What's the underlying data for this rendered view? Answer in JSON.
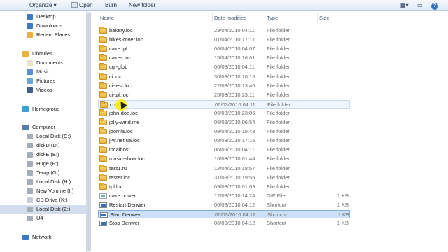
{
  "toolbar": {
    "organize_label": "Organize ▾",
    "open_label": "Open",
    "burn_label": "Burn",
    "new_folder_label": "New folder"
  },
  "nav": {
    "items": [
      {
        "label": "Desktop",
        "icon": "desktop-icon"
      },
      {
        "label": "Downloads",
        "icon": "downloads-folder-icon"
      },
      {
        "label": "Recent Places",
        "icon": "recent-places-icon"
      },
      {
        "label": "Libraries",
        "icon": "libraries-icon"
      },
      {
        "label": "Documents",
        "icon": "documents-icon"
      },
      {
        "label": "Music",
        "icon": "music-icon"
      },
      {
        "label": "Pictures",
        "icon": "pictures-icon"
      },
      {
        "label": "Videos",
        "icon": "videos-icon"
      },
      {
        "label": "Homegroup",
        "icon": "homegroup-icon"
      },
      {
        "label": "Computer",
        "icon": "computer-icon"
      },
      {
        "label": "Local Disk (C:)",
        "icon": "drive-icon"
      },
      {
        "label": "diskD (D:)",
        "icon": "drive-icon"
      },
      {
        "label": "diskE (E:)",
        "icon": "drive-icon"
      },
      {
        "label": "Huge (F:)",
        "icon": "drive-icon"
      },
      {
        "label": "Temp (G:)",
        "icon": "drive-icon"
      },
      {
        "label": "Local Disk (H:)",
        "icon": "drive-icon"
      },
      {
        "label": "New Volume (I:)",
        "icon": "drive-icon"
      },
      {
        "label": "CD Drive (K:)",
        "icon": "cd-drive-icon"
      },
      {
        "label": "Local Disk (Z:)",
        "icon": "drive-icon"
      },
      {
        "label": "U4",
        "icon": "drive-icon"
      },
      {
        "label": "Network",
        "icon": "network-icon"
      }
    ],
    "selected": "Local Disk (Z:)"
  },
  "columns": {
    "name": "Name",
    "date": "Date modified",
    "type": "Type",
    "size": "Size"
  },
  "files": [
    {
      "name": "bakery.loc",
      "date": "23/04/2010 04:11",
      "type": "File folder",
      "size": "",
      "kind": "folder"
    },
    {
      "name": "bikes-rover.loc",
      "date": "01/04/2010 17:17",
      "type": "File folder",
      "size": "",
      "kind": "folder"
    },
    {
      "name": "cake.tpl",
      "date": "06/04/2010 04:07",
      "type": "File folder",
      "size": "",
      "kind": "folder"
    },
    {
      "name": "cakes.loc",
      "date": "15/04/2010 16:01",
      "type": "File folder",
      "size": "",
      "kind": "folder"
    },
    {
      "name": "cgi-glob",
      "date": "06/03/2010 04:11",
      "type": "File folder",
      "size": "",
      "kind": "folder"
    },
    {
      "name": "ci.loc",
      "date": "30/03/2010 10:15",
      "type": "File folder",
      "size": "",
      "kind": "folder"
    },
    {
      "name": "ci-test.loc",
      "date": "22/03/2010 13:46",
      "type": "File folder",
      "size": "",
      "kind": "folder"
    },
    {
      "name": "ci-tpl.loc",
      "date": "25/03/2010 23:11",
      "type": "File folder",
      "size": "",
      "kind": "folder"
    },
    {
      "name": "custom",
      "date": "06/03/2010 04:11",
      "type": "File folder",
      "size": "",
      "kind": "folder"
    },
    {
      "name": "john-doe.loc",
      "date": "06/03/2010 23:06",
      "type": "File folder",
      "size": "",
      "kind": "folder"
    },
    {
      "name": "jolly-wind.me",
      "date": "06/03/2010 06:54",
      "type": "File folder",
      "size": "",
      "kind": "folder"
    },
    {
      "name": "joomla.loc",
      "date": "09/04/2010 18:43",
      "type": "File folder",
      "size": "",
      "kind": "folder"
    },
    {
      "name": "j-w.net.ua.loc",
      "date": "08/03/2010 17:15",
      "type": "File folder",
      "size": "",
      "kind": "folder"
    },
    {
      "name": "localhost",
      "date": "06/03/2010 04:11",
      "type": "File folder",
      "size": "",
      "kind": "folder"
    },
    {
      "name": "music-show.loc",
      "date": "10/03/2010 01:44",
      "type": "File folder",
      "size": "",
      "kind": "folder"
    },
    {
      "name": "test1.ru",
      "date": "12/04/2010 18:57",
      "type": "File folder",
      "size": "",
      "kind": "folder"
    },
    {
      "name": "tester.loc",
      "date": "31/03/2010 19:55",
      "type": "File folder",
      "size": "",
      "kind": "folder"
    },
    {
      "name": "tpl.loc",
      "date": "09/03/2010 01:09",
      "type": "File folder",
      "size": "",
      "kind": "folder"
    },
    {
      "name": "cake.power",
      "date": "12/03/2010 14:24",
      "type": "GIF File",
      "size": "1 KB",
      "kind": "gif"
    },
    {
      "name": "Restart Denwer",
      "date": "06/03/2010 04:12",
      "type": "Shortcut",
      "size": "1 KB",
      "kind": "shortcut"
    },
    {
      "name": "Start Denwer",
      "date": "06/03/2010 04:12",
      "type": "Shortcut",
      "size": "1 KB",
      "kind": "shortcut"
    },
    {
      "name": "Stop Denwer",
      "date": "06/03/2010 04:12",
      "type": "Shortcut",
      "size": "1 KB",
      "kind": "shortcut"
    }
  ],
  "hover_row": 8,
  "selected_row": 20,
  "colors": {
    "toolbar_bg": "#dfe9f5",
    "selection": "#cce0f7",
    "hover": "#eef5fd",
    "folder": "#e8b336",
    "cursor_highlight": "#fff000"
  }
}
